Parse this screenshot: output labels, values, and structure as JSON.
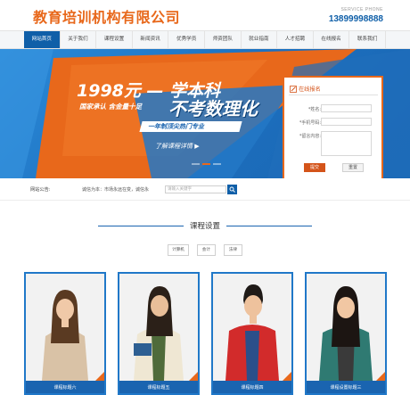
{
  "header": {
    "logo": "教育培训机构有限公司",
    "service_label": "SERVICE PHONE",
    "phone": "13899998888"
  },
  "nav": {
    "items": [
      {
        "label": "网站首页",
        "active": true
      },
      {
        "label": "关于我们",
        "active": false
      },
      {
        "label": "课程设置",
        "active": false
      },
      {
        "label": "新闻资讯",
        "active": false
      },
      {
        "label": "优秀学员",
        "active": false
      },
      {
        "label": "师资团队",
        "active": false
      },
      {
        "label": "就业指南",
        "active": false
      },
      {
        "label": "人才招聘",
        "active": false
      },
      {
        "label": "在线报名",
        "active": false
      },
      {
        "label": "联系我们",
        "active": false
      }
    ]
  },
  "banner": {
    "price": "1998元 — 学本科",
    "subtitle1": "国家承认  含金量十足",
    "headline": "不考数理化",
    "subtitle2": "一年制顶尖热门专业",
    "link": "了解课程详情 ▶",
    "colors": {
      "orange": "#e8681b",
      "blue": "#1a64b0"
    }
  },
  "register": {
    "title": "在线报名",
    "fields": [
      {
        "label": "*姓名:",
        "value": ""
      },
      {
        "label": "*手机号码:",
        "value": ""
      },
      {
        "label": "*留言内容:",
        "value": ""
      }
    ],
    "submit": "提交",
    "reset": "重置"
  },
  "notice": {
    "label": "网站公告:",
    "text": "诚信为本：市场永远在变，诚信永",
    "search_placeholder": "请输入关键字"
  },
  "courses": {
    "title": "课程设置",
    "tags": [
      "计算机",
      "会计",
      "法律"
    ],
    "cards": [
      {
        "caption": "课程标题六"
      },
      {
        "caption": "课程标题五"
      },
      {
        "caption": "课程标题四"
      },
      {
        "caption": "课程设置标题三"
      }
    ]
  }
}
